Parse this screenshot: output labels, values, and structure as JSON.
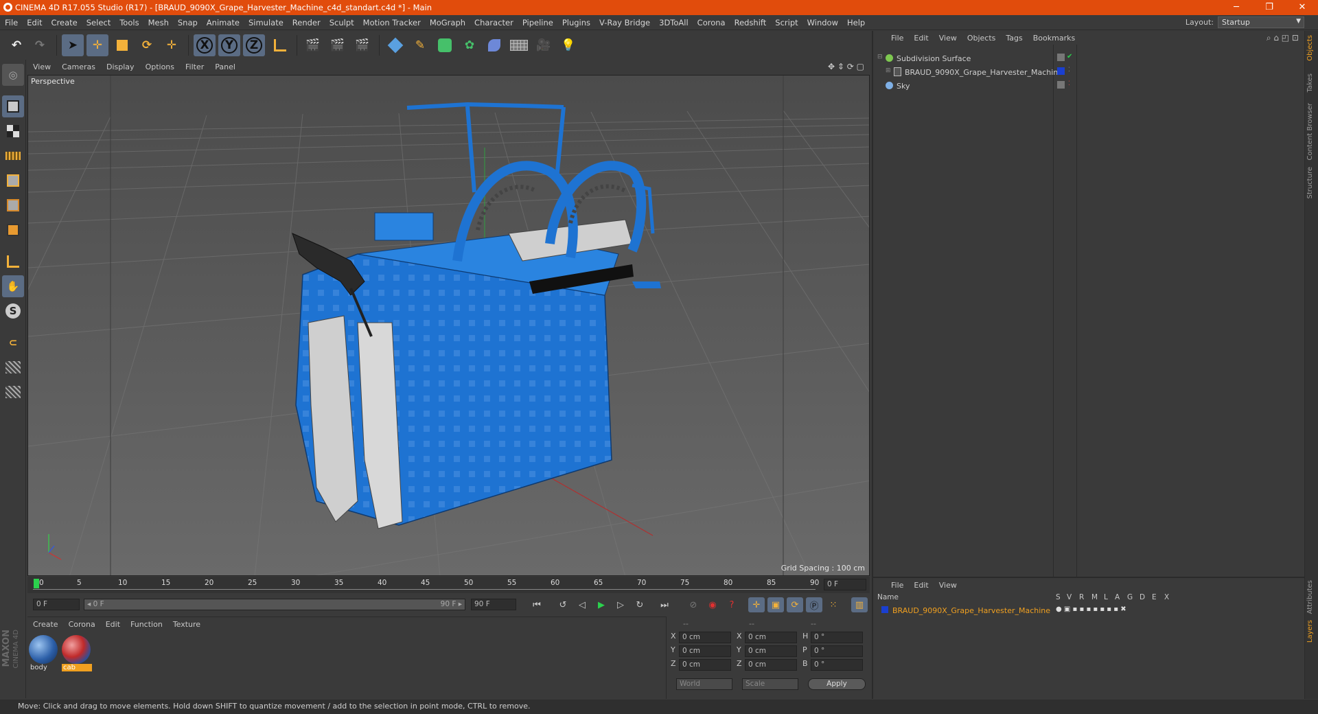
{
  "window": {
    "title": "CINEMA 4D R17.055 Studio (R17) - [BRAUD_9090X_Grape_Harvester_Machine_c4d_standart.c4d *] - Main",
    "controls": [
      "─",
      "❐",
      "✕"
    ]
  },
  "menubar": {
    "items": [
      "File",
      "Edit",
      "Create",
      "Select",
      "Tools",
      "Mesh",
      "Snap",
      "Animate",
      "Simulate",
      "Render",
      "Sculpt",
      "Motion Tracker",
      "MoGraph",
      "Character",
      "Pipeline",
      "Plugins",
      "V-Ray Bridge",
      "3DToAll",
      "Corona",
      "Redshift",
      "Script",
      "Window",
      "Help"
    ],
    "layout_label": "Layout:",
    "layout_value": "Startup"
  },
  "toolbar": {
    "undo": "↶",
    "redo": "↷",
    "axis_x": "X",
    "axis_y": "Y",
    "axis_z": "Z"
  },
  "viewport": {
    "menu": [
      "View",
      "Cameras",
      "Display",
      "Options",
      "Filter",
      "Panel"
    ],
    "camera_label": "Perspective",
    "grid_spacing": "Grid Spacing : 100 cm"
  },
  "timeline": {
    "ticks": [
      "0",
      "5",
      "10",
      "15",
      "20",
      "25",
      "30",
      "35",
      "40",
      "45",
      "50",
      "55",
      "60",
      "65",
      "70",
      "75",
      "80",
      "85",
      "90"
    ],
    "current_frame": "0 F",
    "start_field": "0 F",
    "range_start": "◂ 0 F",
    "range_end": "90 F ▸",
    "end_field": "90 F"
  },
  "material_panel": {
    "menu": [
      "Create",
      "Corona",
      "Edit",
      "Function",
      "Texture"
    ],
    "materials": [
      {
        "name": "body",
        "selected": false
      },
      {
        "name": "cab",
        "selected": true
      }
    ]
  },
  "coord_panel": {
    "headers": [
      "--",
      "--",
      "--"
    ],
    "rows": [
      {
        "a_label": "X",
        "a_val": "0 cm",
        "b_label": "X",
        "b_val": "0 cm",
        "c_label": "H",
        "c_val": "0 °"
      },
      {
        "a_label": "Y",
        "a_val": "0 cm",
        "b_label": "Y",
        "b_val": "0 cm",
        "c_label": "P",
        "c_val": "0 °"
      },
      {
        "a_label": "Z",
        "a_val": "0 cm",
        "b_label": "Z",
        "b_val": "0 cm",
        "c_label": "B",
        "c_val": "0 °"
      }
    ],
    "world": "World",
    "scale": "Scale",
    "apply": "Apply"
  },
  "object_manager": {
    "menu": [
      "File",
      "Edit",
      "View",
      "Objects",
      "Tags",
      "Bookmarks"
    ],
    "objects": [
      {
        "name": "Subdivision Surface",
        "color": "#7ec850"
      },
      {
        "name": "BRAUD_9090X_Grape_Harvester_Machine",
        "color": "#1a3fd0"
      },
      {
        "name": "Sky",
        "color": "#7fb0e6"
      }
    ]
  },
  "layer_manager": {
    "menu": [
      "File",
      "Edit",
      "View"
    ],
    "columns": [
      "Name",
      "S",
      "V",
      "R",
      "M",
      "L",
      "A",
      "G",
      "D",
      "E",
      "X"
    ],
    "layers": [
      {
        "name": "BRAUD_9090X_Grape_Harvester_Machine",
        "color": "#1a3fd0"
      }
    ]
  },
  "right_tabs": {
    "top": [
      "Objects",
      "Takes",
      "Content Browser",
      "Structure"
    ],
    "bottom": [
      "Attributes",
      "Layers"
    ]
  },
  "brand": {
    "line1": "MAXON",
    "line2": "CINEMA 4D"
  },
  "status": "Move: Click and drag to move elements. Hold down SHIFT to quantize movement / add to the selection in point mode, CTRL to remove.",
  "colors": {
    "title_bar": "#e14c0c",
    "model_blue": "#1e73d2",
    "selection_orange": "#f0a020"
  }
}
